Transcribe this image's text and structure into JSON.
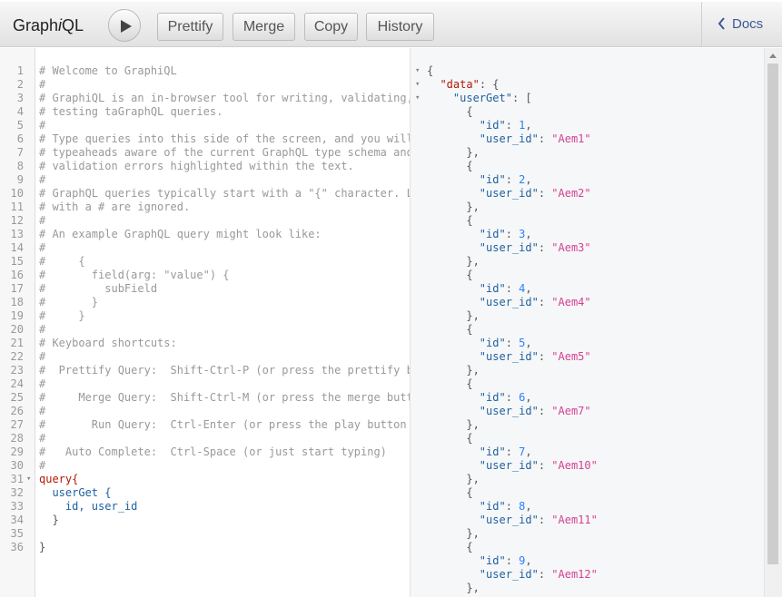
{
  "app": {
    "title_pre": "Graph",
    "title_em": "i",
    "title_post": "QL"
  },
  "toolbar": {
    "prettify": "Prettify",
    "merge": "Merge",
    "copy": "Copy",
    "history": "History",
    "docs": "Docs"
  },
  "editor": {
    "lines": [
      {
        "n": "1",
        "text": "# Welcome to GraphiQL",
        "k": "comment"
      },
      {
        "n": "2",
        "text": "#",
        "k": "comment"
      },
      {
        "n": "3",
        "text": "# GraphiQL is an in-browser tool for writing, validating,",
        "k": "comment"
      },
      {
        "n": "4",
        "text": "# testing taGraphQL queries.",
        "k": "comment"
      },
      {
        "n": "5",
        "text": "#",
        "k": "comment"
      },
      {
        "n": "6",
        "text": "# Type queries into this side of the screen, and you will",
        "k": "comment"
      },
      {
        "n": "7",
        "text": "# typeaheads aware of the current GraphQL type schema and",
        "k": "comment"
      },
      {
        "n": "8",
        "text": "# validation errors highlighted within the text.",
        "k": "comment"
      },
      {
        "n": "9",
        "text": "#",
        "k": "comment"
      },
      {
        "n": "10",
        "text": "# GraphQL queries typically start with a \"{\" character. L",
        "k": "comment"
      },
      {
        "n": "11",
        "text": "# with a # are ignored.",
        "k": "comment"
      },
      {
        "n": "12",
        "text": "#",
        "k": "comment"
      },
      {
        "n": "13",
        "text": "# An example GraphQL query might look like:",
        "k": "comment"
      },
      {
        "n": "14",
        "text": "#",
        "k": "comment"
      },
      {
        "n": "15",
        "text": "#     {",
        "k": "comment"
      },
      {
        "n": "16",
        "text": "#       field(arg: \"value\") {",
        "k": "comment"
      },
      {
        "n": "17",
        "text": "#         subField",
        "k": "comment"
      },
      {
        "n": "18",
        "text": "#       }",
        "k": "comment"
      },
      {
        "n": "19",
        "text": "#     }",
        "k": "comment"
      },
      {
        "n": "20",
        "text": "#",
        "k": "comment"
      },
      {
        "n": "21",
        "text": "# Keyboard shortcuts:",
        "k": "comment"
      },
      {
        "n": "22",
        "text": "#",
        "k": "comment"
      },
      {
        "n": "23",
        "text": "#  Prettify Query:  Shift-Ctrl-P (or press the prettify b",
        "k": "comment"
      },
      {
        "n": "24",
        "text": "#",
        "k": "comment"
      },
      {
        "n": "25",
        "text": "#     Merge Query:  Shift-Ctrl-M (or press the merge butt",
        "k": "comment"
      },
      {
        "n": "26",
        "text": "#",
        "k": "comment"
      },
      {
        "n": "27",
        "text": "#       Run Query:  Ctrl-Enter (or press the play button",
        "k": "comment"
      },
      {
        "n": "28",
        "text": "#",
        "k": "comment"
      },
      {
        "n": "29",
        "text": "#   Auto Complete:  Ctrl-Space (or just start typing)",
        "k": "comment"
      },
      {
        "n": "30",
        "text": "#",
        "k": "comment"
      },
      {
        "n": "31",
        "text": "query{",
        "k": "keyword",
        "fold": true
      },
      {
        "n": "32",
        "text": "  userGet {",
        "k": "field"
      },
      {
        "n": "33",
        "text": "    id, user_id",
        "k": "field"
      },
      {
        "n": "34",
        "text": "  }",
        "k": "punct"
      },
      {
        "n": "35",
        "text": "",
        "k": "punct"
      },
      {
        "n": "36",
        "text": "}",
        "k": "punct"
      }
    ]
  },
  "result": {
    "lines": [
      {
        "segs": [
          [
            "{",
            "punct"
          ]
        ],
        "fold": true
      },
      {
        "segs": [
          [
            "  ",
            "punct"
          ],
          [
            "\"data\"",
            "topkey"
          ],
          [
            ": {",
            "punct"
          ]
        ],
        "fold": true
      },
      {
        "segs": [
          [
            "    ",
            "punct"
          ],
          [
            "\"userGet\"",
            "key"
          ],
          [
            ": [",
            "punct"
          ]
        ],
        "fold": true
      },
      {
        "segs": [
          [
            "      {",
            "punct"
          ]
        ]
      },
      {
        "segs": [
          [
            "        ",
            "punct"
          ],
          [
            "\"id\"",
            "key"
          ],
          [
            ": ",
            "punct"
          ],
          [
            "1",
            "num"
          ],
          [
            ",",
            "punct"
          ]
        ]
      },
      {
        "segs": [
          [
            "        ",
            "punct"
          ],
          [
            "\"user_id\"",
            "key"
          ],
          [
            ": ",
            "punct"
          ],
          [
            "\"Aem1\"",
            "str"
          ]
        ]
      },
      {
        "segs": [
          [
            "      },",
            "punct"
          ]
        ]
      },
      {
        "segs": [
          [
            "      {",
            "punct"
          ]
        ]
      },
      {
        "segs": [
          [
            "        ",
            "punct"
          ],
          [
            "\"id\"",
            "key"
          ],
          [
            ": ",
            "punct"
          ],
          [
            "2",
            "num"
          ],
          [
            ",",
            "punct"
          ]
        ]
      },
      {
        "segs": [
          [
            "        ",
            "punct"
          ],
          [
            "\"user_id\"",
            "key"
          ],
          [
            ": ",
            "punct"
          ],
          [
            "\"Aem2\"",
            "str"
          ]
        ]
      },
      {
        "segs": [
          [
            "      },",
            "punct"
          ]
        ]
      },
      {
        "segs": [
          [
            "      {",
            "punct"
          ]
        ]
      },
      {
        "segs": [
          [
            "        ",
            "punct"
          ],
          [
            "\"id\"",
            "key"
          ],
          [
            ": ",
            "punct"
          ],
          [
            "3",
            "num"
          ],
          [
            ",",
            "punct"
          ]
        ]
      },
      {
        "segs": [
          [
            "        ",
            "punct"
          ],
          [
            "\"user_id\"",
            "key"
          ],
          [
            ": ",
            "punct"
          ],
          [
            "\"Aem3\"",
            "str"
          ]
        ]
      },
      {
        "segs": [
          [
            "      },",
            "punct"
          ]
        ]
      },
      {
        "segs": [
          [
            "      {",
            "punct"
          ]
        ]
      },
      {
        "segs": [
          [
            "        ",
            "punct"
          ],
          [
            "\"id\"",
            "key"
          ],
          [
            ": ",
            "punct"
          ],
          [
            "4",
            "num"
          ],
          [
            ",",
            "punct"
          ]
        ]
      },
      {
        "segs": [
          [
            "        ",
            "punct"
          ],
          [
            "\"user_id\"",
            "key"
          ],
          [
            ": ",
            "punct"
          ],
          [
            "\"Aem4\"",
            "str"
          ]
        ]
      },
      {
        "segs": [
          [
            "      },",
            "punct"
          ]
        ]
      },
      {
        "segs": [
          [
            "      {",
            "punct"
          ]
        ]
      },
      {
        "segs": [
          [
            "        ",
            "punct"
          ],
          [
            "\"id\"",
            "key"
          ],
          [
            ": ",
            "punct"
          ],
          [
            "5",
            "num"
          ],
          [
            ",",
            "punct"
          ]
        ]
      },
      {
        "segs": [
          [
            "        ",
            "punct"
          ],
          [
            "\"user_id\"",
            "key"
          ],
          [
            ": ",
            "punct"
          ],
          [
            "\"Aem5\"",
            "str"
          ]
        ]
      },
      {
        "segs": [
          [
            "      },",
            "punct"
          ]
        ]
      },
      {
        "segs": [
          [
            "      {",
            "punct"
          ]
        ]
      },
      {
        "segs": [
          [
            "        ",
            "punct"
          ],
          [
            "\"id\"",
            "key"
          ],
          [
            ": ",
            "punct"
          ],
          [
            "6",
            "num"
          ],
          [
            ",",
            "punct"
          ]
        ]
      },
      {
        "segs": [
          [
            "        ",
            "punct"
          ],
          [
            "\"user_id\"",
            "key"
          ],
          [
            ": ",
            "punct"
          ],
          [
            "\"Aem7\"",
            "str"
          ]
        ]
      },
      {
        "segs": [
          [
            "      },",
            "punct"
          ]
        ]
      },
      {
        "segs": [
          [
            "      {",
            "punct"
          ]
        ]
      },
      {
        "segs": [
          [
            "        ",
            "punct"
          ],
          [
            "\"id\"",
            "key"
          ],
          [
            ": ",
            "punct"
          ],
          [
            "7",
            "num"
          ],
          [
            ",",
            "punct"
          ]
        ]
      },
      {
        "segs": [
          [
            "        ",
            "punct"
          ],
          [
            "\"user_id\"",
            "key"
          ],
          [
            ": ",
            "punct"
          ],
          [
            "\"Aem10\"",
            "str"
          ]
        ]
      },
      {
        "segs": [
          [
            "      },",
            "punct"
          ]
        ]
      },
      {
        "segs": [
          [
            "      {",
            "punct"
          ]
        ]
      },
      {
        "segs": [
          [
            "        ",
            "punct"
          ],
          [
            "\"id\"",
            "key"
          ],
          [
            ": ",
            "punct"
          ],
          [
            "8",
            "num"
          ],
          [
            ",",
            "punct"
          ]
        ]
      },
      {
        "segs": [
          [
            "        ",
            "punct"
          ],
          [
            "\"user_id\"",
            "key"
          ],
          [
            ": ",
            "punct"
          ],
          [
            "\"Aem11\"",
            "str"
          ]
        ]
      },
      {
        "segs": [
          [
            "      },",
            "punct"
          ]
        ]
      },
      {
        "segs": [
          [
            "      {",
            "punct"
          ]
        ]
      },
      {
        "segs": [
          [
            "        ",
            "punct"
          ],
          [
            "\"id\"",
            "key"
          ],
          [
            ": ",
            "punct"
          ],
          [
            "9",
            "num"
          ],
          [
            ",",
            "punct"
          ]
        ]
      },
      {
        "segs": [
          [
            "        ",
            "punct"
          ],
          [
            "\"user_id\"",
            "key"
          ],
          [
            ": ",
            "punct"
          ],
          [
            "\"Aem12\"",
            "str"
          ]
        ]
      },
      {
        "segs": [
          [
            "      },",
            "punct"
          ]
        ]
      }
    ]
  },
  "icons": {
    "play": "play-icon",
    "docs_chevron": "chevron-left-icon",
    "fold": "fold-arrow-icon",
    "scroll_up": "scroll-up-arrow-icon"
  }
}
